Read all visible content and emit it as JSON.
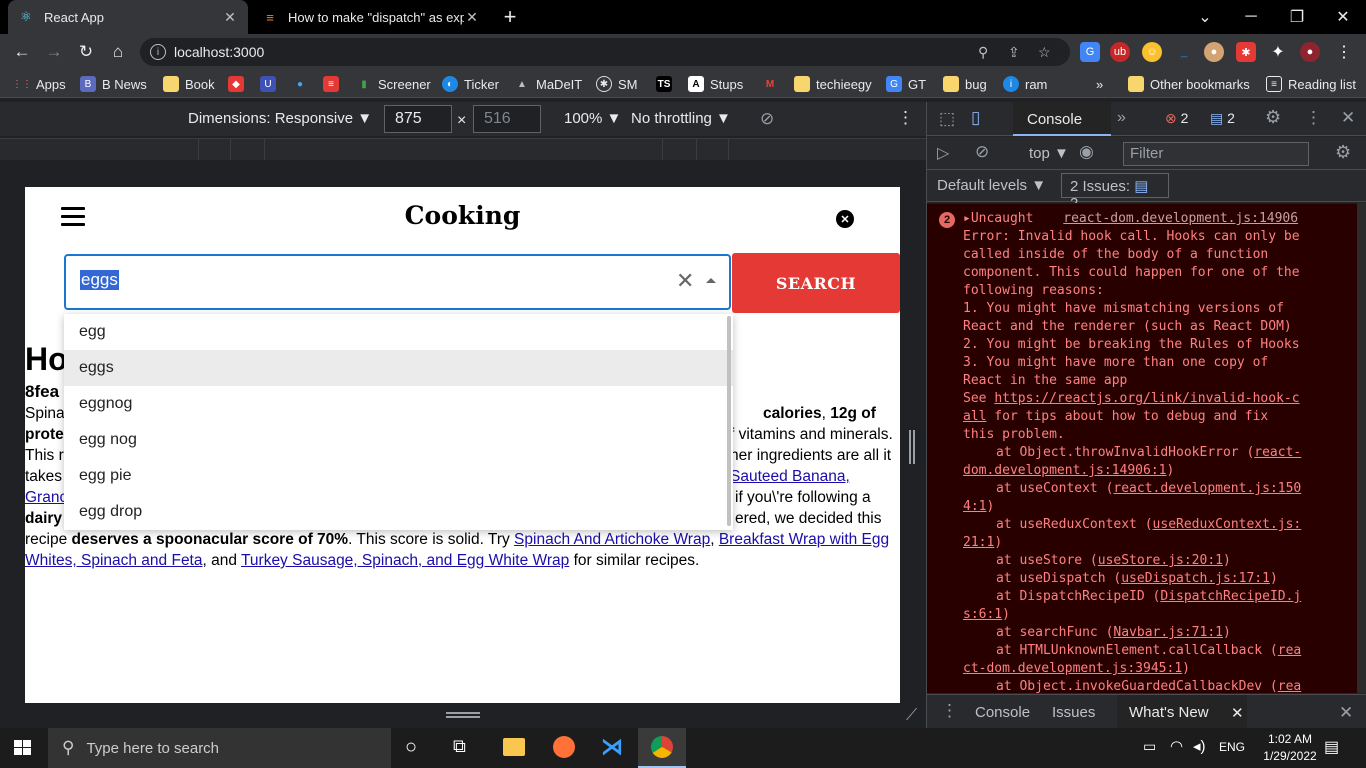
{
  "browser": {
    "tabs": [
      {
        "title": "React App",
        "active": true
      },
      {
        "title": "How to make \"dispatch\" as expor",
        "active": false
      }
    ],
    "new_tab": "+",
    "window_controls": [
      "⌄",
      "─",
      "❐",
      "✕"
    ],
    "url": "localhost:3000",
    "bookmarks": [
      "Apps",
      "B News",
      "Book",
      "",
      "",
      "",
      "",
      "Screener",
      "Ticker",
      "MaDeIT",
      "SM",
      "",
      "Stups",
      "",
      "techieegy",
      "GT",
      "bug",
      "ram"
    ],
    "more_bookmarks": "»",
    "other_bookmarks": "Other bookmarks",
    "reading_list": "Reading list"
  },
  "device_toolbar": {
    "dimensions_label": "Dimensions: Responsive ▼",
    "width": "875",
    "times": "×",
    "height_placeholder": "516",
    "zoom": "100% ▼",
    "throttling": "No throttling ▼"
  },
  "app": {
    "brand": "Cooking",
    "close": "✕",
    "search_value": "eggs",
    "search_button": "SEARCH",
    "suggestions": [
      "egg",
      "eggs",
      "eggnog",
      "egg nog",
      "egg pie",
      "egg drop"
    ],
    "selected_suggestion": "eggs"
  },
  "article": {
    "title_fragment": "Ho",
    "subtitle_fragment": "8fea",
    "l1_start": "Spina",
    "l1_bold": "calories",
    "l1_mid": ", ",
    "l1_bold2": "12g of",
    "l2_start": "prote",
    "l2_end": "f vitamins and minerals.",
    "l3_start": "This r",
    "l3_end": "her ingredients are all it",
    "l4_start": "takes",
    "l4_link": "Sauteed Banana,",
    "l5_link_start": "Granc",
    "l5_end": "if you\\'re following a",
    "l6_bold_start": "dairy",
    "l6_end": "ered, we decided this",
    "l7_text1": "recipe ",
    "l7_bold": "deserves a spoonacular score of 70%",
    "l7_text2": ". This score is solid. Try ",
    "l7_link1": "Spinach And Artichoke Wrap",
    "l7_text3": ", ",
    "l7_link2": "Breakfast Wrap with Egg",
    "l8_link2b": "Whites, Spinach and Feta",
    "l8_text1": ", and ",
    "l8_link3": "Turkey Sausage, Spinach, and Egg White Wrap",
    "l8_text2": " for similar recipes."
  },
  "devtools": {
    "tab_console": "Console",
    "more_tabs": "»",
    "error_count": "2",
    "message_count": "2",
    "context": "top ▼",
    "filter_placeholder": "Filter",
    "levels": "Default levels ▼",
    "issues": "2 Issues:",
    "issues_count": "2",
    "console_badge": "2",
    "console_lines": [
      "▸Uncaught   ",
      "Error: Invalid hook call. Hooks can only be",
      "called inside of the body of a function",
      "component. This could happen for one of the",
      "following reasons:",
      "1. You might have mismatching versions of",
      "React and the renderer (such as React DOM)",
      "2. You might be breaking the Rules of Hooks",
      "3. You might have more than one copy of",
      "React in the same app"
    ],
    "uncaught_source": "react-dom.development.js:14906",
    "see_prefix": "See ",
    "see_link1": "https://reactjs.org/link/invalid-hook-c",
    "see_link2": "all",
    "see_suffix": " for tips about how to debug and fix",
    "see_last": "this problem.",
    "stack": [
      {
        "pre": "at Object.throwInvalidHookError (",
        "link": "react-",
        "post": ""
      },
      {
        "pre": "",
        "link": "dom.development.js:14906:1",
        "post": ")",
        "cont": true
      },
      {
        "pre": "at useContext (",
        "link": "react.development.js:150",
        "post": ""
      },
      {
        "pre": "",
        "link": "4:1",
        "post": ")",
        "cont": true
      },
      {
        "pre": "at useReduxContext (",
        "link": "useReduxContext.js:",
        "post": ""
      },
      {
        "pre": "",
        "link": "21:1",
        "post": ")",
        "cont": true
      },
      {
        "pre": "at useStore (",
        "link": "useStore.js:20:1",
        "post": ")"
      },
      {
        "pre": "at useDispatch (",
        "link": "useDispatch.js:17:1",
        "post": ")"
      },
      {
        "pre": "at DispatchRecipeID (",
        "link": "DispatchRecipeID.j",
        "post": ""
      },
      {
        "pre": "",
        "link": "s:6:1",
        "post": ")",
        "cont": true
      },
      {
        "pre": "at searchFunc (",
        "link": "Navbar.js:71:1",
        "post": ")"
      },
      {
        "pre": "at HTMLUnknownElement.callCallback (",
        "link": "rea",
        "post": ""
      },
      {
        "pre": "",
        "link": "ct-dom.development.js:3945:1",
        "post": ")",
        "cont": true
      },
      {
        "pre": "at Object.invokeGuardedCallbackDev (",
        "link": "rea",
        "post": ""
      }
    ],
    "drawer_tabs": [
      "Console",
      "Issues",
      "What's New"
    ],
    "drawer_close": "✕"
  },
  "taskbar": {
    "search_placeholder": "Type here to search",
    "lang": "ENG",
    "time": "1:02 AM",
    "date": "1/29/2022"
  }
}
